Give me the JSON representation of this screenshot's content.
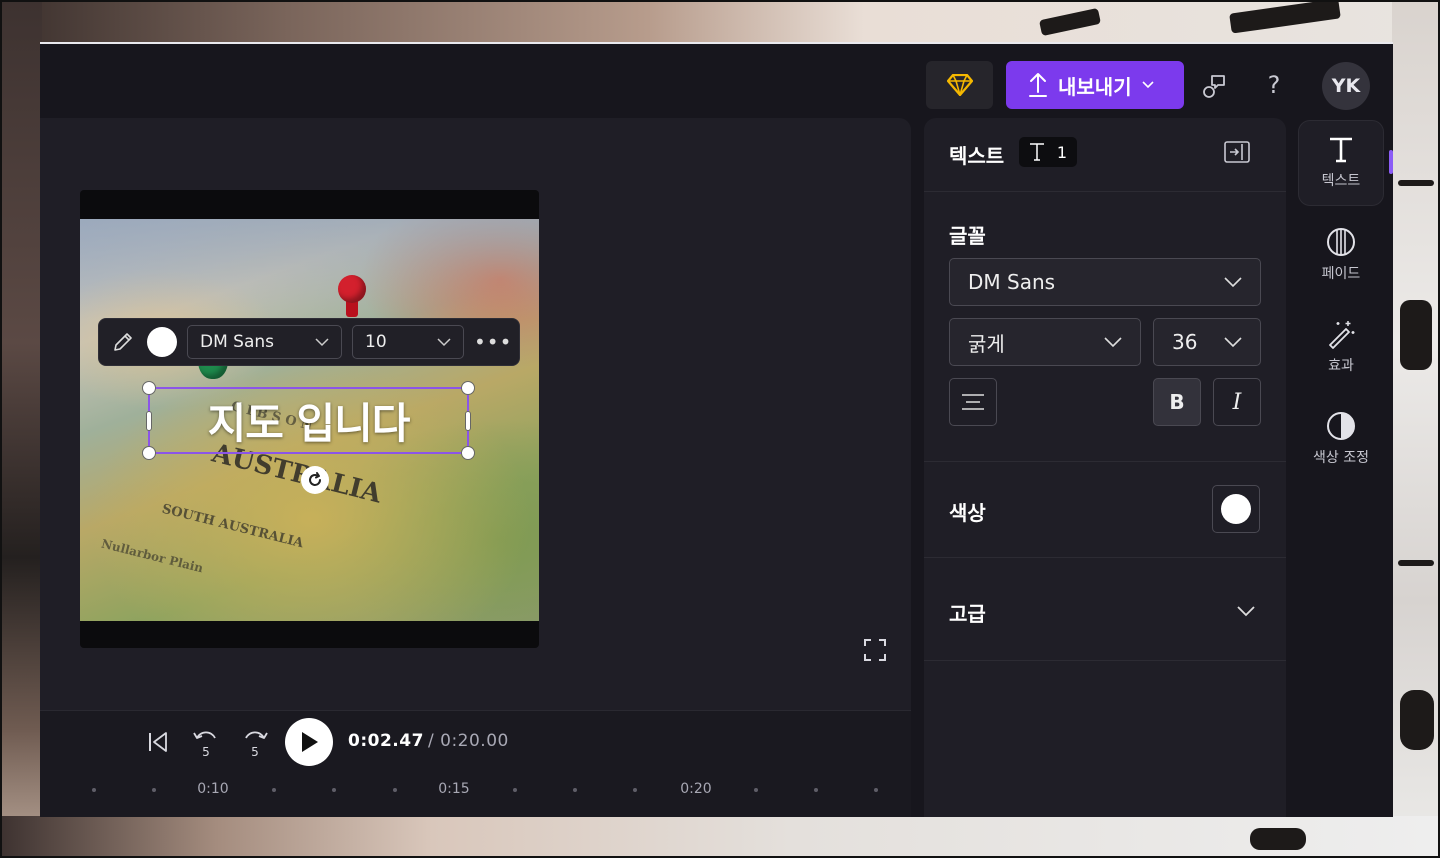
{
  "header": {
    "export_label": "내보내기",
    "avatar_initials": "YK",
    "help_label": "?"
  },
  "floating_toolbar": {
    "font": "DM Sans",
    "size": "10",
    "color": "#ffffff"
  },
  "canvas": {
    "overlay_text": "지도 입니다"
  },
  "player": {
    "skip_back_seconds": "5",
    "skip_forward_seconds": "5",
    "current_time": "0:02.47",
    "total_time": "/ 0:20.00",
    "ruler_labels": [
      "0:10",
      "0:15",
      "0:20"
    ]
  },
  "panel": {
    "title": "텍스트",
    "layer_count": "1",
    "font_section_label": "글꼴",
    "font_family": "DM Sans",
    "font_weight": "굵게",
    "font_size": "36",
    "bold_label": "B",
    "italic_label": "I",
    "color_section_label": "색상",
    "text_color": "#ffffff",
    "advanced_section_label": "고급"
  },
  "rail": {
    "items": [
      {
        "label": "텍스트",
        "icon": "text-icon",
        "active": true
      },
      {
        "label": "페이드",
        "icon": "fade-icon",
        "active": false
      },
      {
        "label": "효과",
        "icon": "magic-wand-icon",
        "active": false
      },
      {
        "label": "색상 조정",
        "icon": "contrast-icon",
        "active": false
      }
    ]
  },
  "colors": {
    "accent": "#7c3aed",
    "selection": "#8b55e8",
    "app_bg": "#17161d",
    "panel_bg": "#1f1e26",
    "premium": "#f5b800"
  }
}
